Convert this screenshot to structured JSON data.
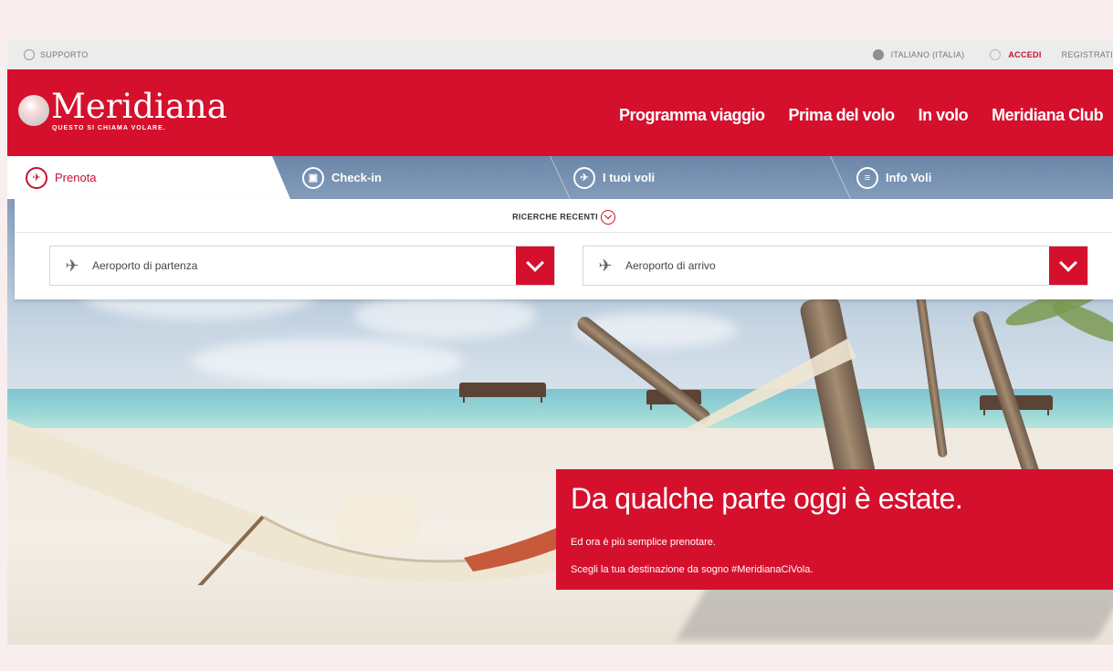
{
  "utility": {
    "support": "SUPPORTO",
    "language": "ITALIANO (ITALIA)",
    "login": "ACCEDI",
    "register": "REGISTRATI"
  },
  "brand": {
    "name": "Meridiana",
    "tagline": "QUESTO SI CHIAMA VOLARE."
  },
  "nav": [
    {
      "label": "Programma viaggio"
    },
    {
      "label": "Prima del volo"
    },
    {
      "label": "In volo"
    },
    {
      "label": "Meridiana Club"
    }
  ],
  "tabs": [
    {
      "label": "Prenota",
      "icon": "plane-icon",
      "active": true
    },
    {
      "label": "Check-in",
      "icon": "checkin-icon"
    },
    {
      "label": "I tuoi voli",
      "icon": "flight-search-icon"
    },
    {
      "label": "Info Voli",
      "icon": "info-icon"
    }
  ],
  "search": {
    "recent_label": "RICERCHE RECENTI",
    "departure_placeholder": "Aeroporto di partenza",
    "arrival_placeholder": "Aeroporto di arrivo"
  },
  "promo": {
    "title": "Da qualche parte oggi è estate.",
    "line1": "Ed ora è più semplice prenotare.",
    "line2": "Scegli la tua destinazione da sogno #MeridianaCiVola."
  },
  "colors": {
    "brand_red": "#d5102d"
  }
}
